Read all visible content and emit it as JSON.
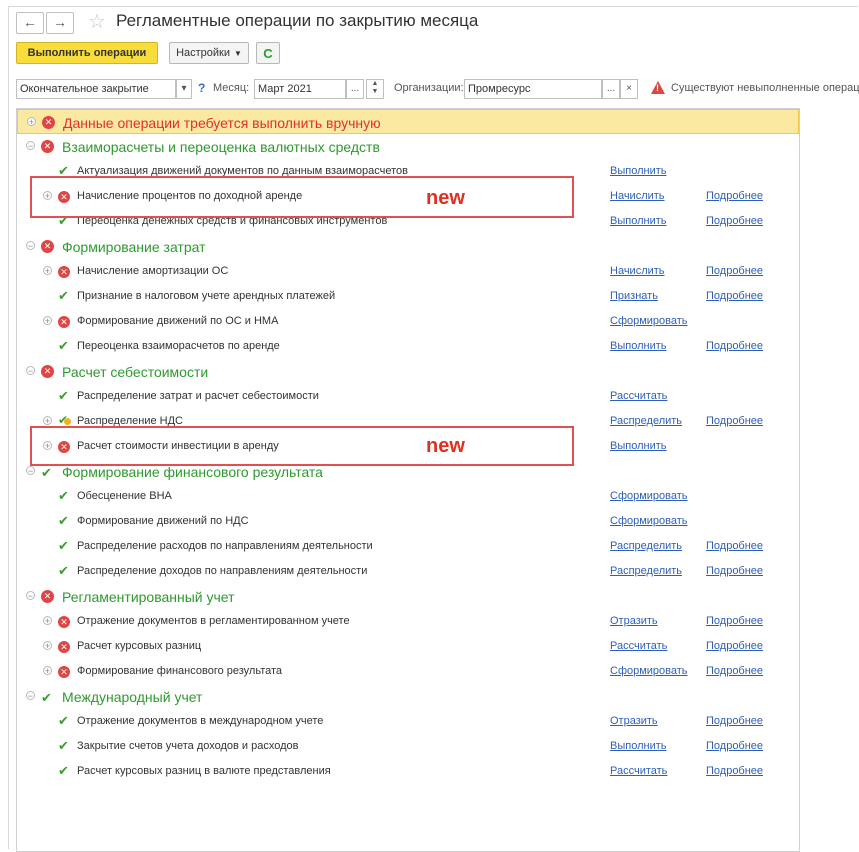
{
  "window": {
    "title": "Регламентные операции по закрытию месяца",
    "back_icon": "←",
    "forward_icon": "→",
    "star_icon": "☆"
  },
  "toolbar": {
    "run_label": "Выполнить операции",
    "settings_label": "Настройки",
    "refresh_icon": "C"
  },
  "filter": {
    "mode_value": "Окончательное закрытие",
    "help": "?",
    "month_label": "Месяц:",
    "month_value": "Март 2021",
    "org_label": "Организации:",
    "org_value": "Промресурс",
    "warning_text": "Существуют невыполненные операции"
  },
  "colors": {
    "accent": "#f8dc3c",
    "ok": "#3a9e2e",
    "error": "#e04545",
    "link": "#2d5fb8"
  },
  "more_label": "Подробнее",
  "annotation_label": "new",
  "groups": [
    {
      "name": "Данные операции требуется выполнить вручную",
      "status": "error",
      "highlight": true,
      "items": []
    },
    {
      "name": "Взаиморасчеты и переоценка валютных средств",
      "status": "error",
      "items": [
        {
          "name": "Актуализация движений документов по данным взаиморасчетов",
          "status": "ok",
          "action": "Выполнить",
          "more": false
        },
        {
          "name": "Начисление процентов по доходной аренде",
          "status": "error",
          "action": "Начислить",
          "more": true
        },
        {
          "name": "Переоценка денежных средств и финансовых инструментов",
          "status": "ok",
          "action": "Выполнить",
          "more": true
        }
      ]
    },
    {
      "name": "Формирование затрат",
      "status": "error",
      "items": [
        {
          "name": "Начисление амортизации ОС",
          "status": "error",
          "action": "Начислить",
          "more": true
        },
        {
          "name": "Признание в налоговом учете арендных платежей",
          "status": "ok",
          "action": "Признать",
          "more": true
        },
        {
          "name": "Формирование движений по ОС и НМА",
          "status": "error",
          "action": "Сформировать",
          "more": false
        },
        {
          "name": "Переоценка взаиморасчетов по аренде",
          "status": "ok",
          "action": "Выполнить",
          "more": true
        }
      ]
    },
    {
      "name": "Расчет себестоимости",
      "status": "error",
      "items": [
        {
          "name": "Распределение затрат и расчет себестоимости",
          "status": "ok",
          "action": "Рассчитать",
          "more": false
        },
        {
          "name": "Распределение НДС",
          "status": "mixed",
          "action": "Распределить",
          "more": true
        },
        {
          "name": "Расчет стоимости инвестиции в аренду",
          "status": "error",
          "action": "Выполнить",
          "more": false
        }
      ]
    },
    {
      "name": "Формирование финансового результата",
      "status": "ok",
      "items": [
        {
          "name": "Обесценение ВНА",
          "status": "ok",
          "action": "Сформировать",
          "more": false
        },
        {
          "name": "Формирование движений по НДС",
          "status": "ok",
          "action": "Сформировать",
          "more": false
        },
        {
          "name": "Распределение расходов по направлениям деятельности",
          "status": "ok",
          "action": "Распределить",
          "more": true
        },
        {
          "name": "Распределение доходов по направлениям деятельности",
          "status": "ok",
          "action": "Распределить",
          "more": true
        }
      ]
    },
    {
      "name": "Регламентированный учет",
      "status": "error",
      "items": [
        {
          "name": "Отражение документов в регламентированном учете",
          "status": "error",
          "action": "Отразить",
          "more": true
        },
        {
          "name": "Расчет курсовых разниц",
          "status": "error",
          "action": "Рассчитать",
          "more": true
        },
        {
          "name": "Формирование финансового результата",
          "status": "error",
          "action": "Сформировать",
          "more": true
        }
      ]
    },
    {
      "name": "Международный учет",
      "status": "ok",
      "items": [
        {
          "name": "Отражение документов в международном учете",
          "status": "ok",
          "action": "Отразить",
          "more": true
        },
        {
          "name": "Закрытие счетов учета доходов и расходов",
          "status": "ok",
          "action": "Выполнить",
          "more": true
        },
        {
          "name": "Расчет курсовых разниц в валюте представления",
          "status": "ok",
          "action": "Рассчитать",
          "more": true
        }
      ]
    }
  ]
}
